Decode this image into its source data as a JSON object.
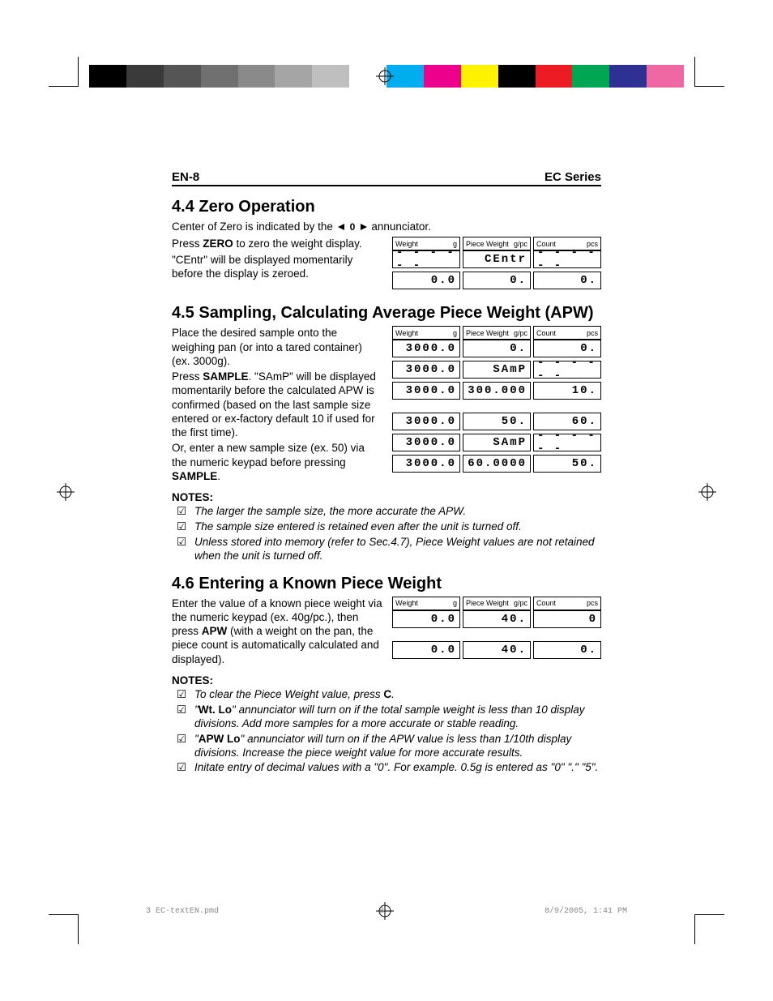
{
  "header": {
    "left": "EN-8",
    "right": "EC Series"
  },
  "sec44": {
    "title": "4.4 Zero Operation",
    "intro_a": "Center of Zero is indicated by the ",
    "intro_b": " annunciator.",
    "p1a": "Press ",
    "p1b": "ZERO",
    "p1c": " to zero the weight display.",
    "p2": "\"CEntr\" will be displayed momentarily before the display is zeroed.",
    "disp": {
      "hdr": {
        "w1": "Weight",
        "w2": "g",
        "p1": "Piece Weight",
        "p2": "g/pc",
        "c1": "Count",
        "c2": "pcs"
      },
      "r1": {
        "w": "- - - - - -",
        "p": "CEntr",
        "c": "- - - - - -"
      },
      "r2": {
        "w": "0.0",
        "p": "0.",
        "c": "0."
      }
    }
  },
  "sec45": {
    "title": "4.5 Sampling, Calculating Average Piece Weight (APW)",
    "p1": "Place the desired sample onto the weighing pan (or into a tared container) (ex. 3000g).",
    "p2a": "Press ",
    "p2b": "SAMPLE",
    "p2c": ".  \"SAmP\" will be displayed momentarily before the calculated APW is confirmed (based on the last sample size entered or ex-factory default 10 if used for the first time).",
    "p3a": "Or, enter a new sample size (ex. 50) via the numeric keypad before pressing ",
    "p3b": "SAMPLE",
    "p3c": ".",
    "disp": {
      "hdr": {
        "w1": "Weight",
        "w2": "g",
        "p1": "Piece Weight",
        "p2": "g/pc",
        "c1": "Count",
        "c2": "pcs"
      },
      "a1": {
        "w": "3000.0",
        "p": "0.",
        "c": "0."
      },
      "a2": {
        "w": "3000.0",
        "p": "SAmP",
        "c": "- - - - - -"
      },
      "a3": {
        "w": "3000.0",
        "p": "300.000",
        "c": "10."
      },
      "b1": {
        "w": "3000.0",
        "p": "50.",
        "c": "60."
      },
      "b2": {
        "w": "3000.0",
        "p": "SAmP",
        "c": "- - - - - -"
      },
      "b3": {
        "w": "3000.0",
        "p": "60.0000",
        "c": "50."
      }
    },
    "notes_label": "NOTES:",
    "notes": [
      "The larger the sample size, the more accurate the APW.",
      "The sample size entered is retained even after the unit is turned off.",
      "Unless stored into memory (refer to Sec.4.7), Piece Weight values are not retained when the unit is turned off."
    ]
  },
  "sec46": {
    "title": "4.6 Entering a Known Piece Weight",
    "p1a": "Enter the value of a known piece weight via the numeric keypad (ex. 40g/pc.), then press ",
    "p1b": "APW",
    "p1c": " (with a weight on the pan, the piece count is automatically calculated and displayed).",
    "disp": {
      "hdr": {
        "w1": "Weight",
        "w2": "g",
        "p1": "Piece Weight",
        "p2": "g/pc",
        "c1": "Count",
        "c2": "pcs"
      },
      "r1": {
        "w": "0.0",
        "p": "40.",
        "c": "0"
      },
      "r2": {
        "w": "0.0",
        "p": "40.",
        "c": "0."
      }
    },
    "notes_label": "NOTES:",
    "notes": {
      "n1a": "To clear the Piece Weight value, press ",
      "n1b": "C",
      "n1c": ".",
      "n2a": "\"",
      "n2b": "Wt. Lo",
      "n2c": "\" annunciator will turn on if the total sample weight is less than 10 display divisions.  Add more samples for a more accurate or stable reading.",
      "n3a": "\"",
      "n3b": "APW Lo",
      "n3c": "\" annunciator will turn on if the APW value is less than 1/10th display divisions.  Increase the piece weight value for more accurate results.",
      "n4": "Initate entry of decimal values with a \"0\".  For example. 0.5g is entered as \"0\" \".\" \"5\"."
    }
  },
  "footer": {
    "file": "3 EC-textEN.pmd",
    "page": "8",
    "stamp": "8/9/2005, 1:41 PM"
  },
  "colors": [
    "#000",
    "#3a3a3a",
    "#555",
    "#707070",
    "#8a8a8a",
    "#a5a5a5",
    "#bfbfbf",
    "#fff",
    "#00aeef",
    "#ec008c",
    "#fff200",
    "#000",
    "#ed1c24",
    "#00a651",
    "#2e3192",
    "#f068a3"
  ]
}
